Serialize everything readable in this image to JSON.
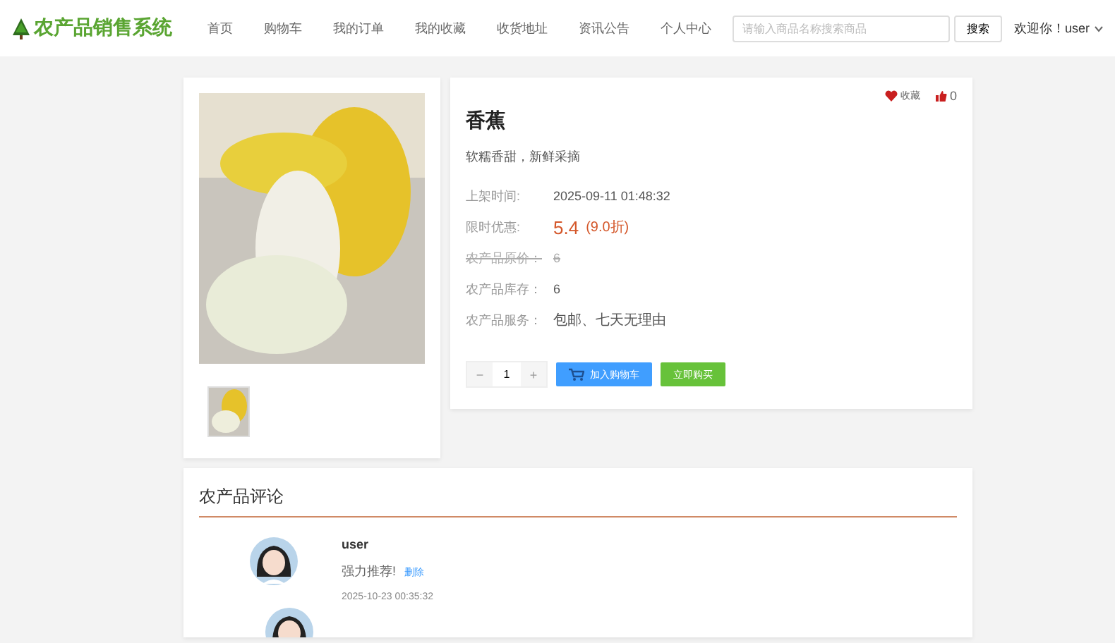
{
  "header": {
    "logo": "农产品销售系统",
    "nav": [
      {
        "label": "首页",
        "selected": false
      },
      {
        "label": "购物车",
        "selected": false
      },
      {
        "label": "我的订单",
        "selected": false
      },
      {
        "label": "我的收藏",
        "selected": false
      },
      {
        "label": "收货地址",
        "selected": false
      },
      {
        "label": "资讯公告",
        "selected": false
      },
      {
        "label": "个人中心",
        "selected": false
      }
    ],
    "search": {
      "placeholder": "请输入商品名称搜索商品",
      "button": "搜索"
    },
    "welcome": "欢迎你！user"
  },
  "product": {
    "favorite_label": "收藏",
    "likes": "0",
    "name": "香蕉",
    "description": "软糯香甜，新鲜采摘",
    "rows": [
      {
        "kind": "text",
        "label": "上架时间:",
        "value": "2025-09-11 01:48:32",
        "struck": false
      },
      {
        "kind": "price",
        "label": "限时优惠:",
        "value": "5.4",
        "discount": "(9.0折)",
        "struck": false
      },
      {
        "kind": "text",
        "label": "农产品原价：",
        "value": "6",
        "struck": true
      },
      {
        "kind": "text",
        "label": "农产品库存：",
        "value": "6",
        "struck": false
      },
      {
        "kind": "service",
        "label": "农产品服务：",
        "value": "包邮、七天无理由",
        "struck": false
      }
    ],
    "quantity": {
      "minus": "−",
      "value": "1",
      "plus": "+"
    },
    "add_to_cart": "加入购物车",
    "buy_now": "立即购买"
  },
  "comments": {
    "title": "农产品评论",
    "items": [
      {
        "user": "user",
        "text": "强力推荐!",
        "delete": "删除",
        "time": "2025-10-23 00:35:32"
      }
    ]
  }
}
